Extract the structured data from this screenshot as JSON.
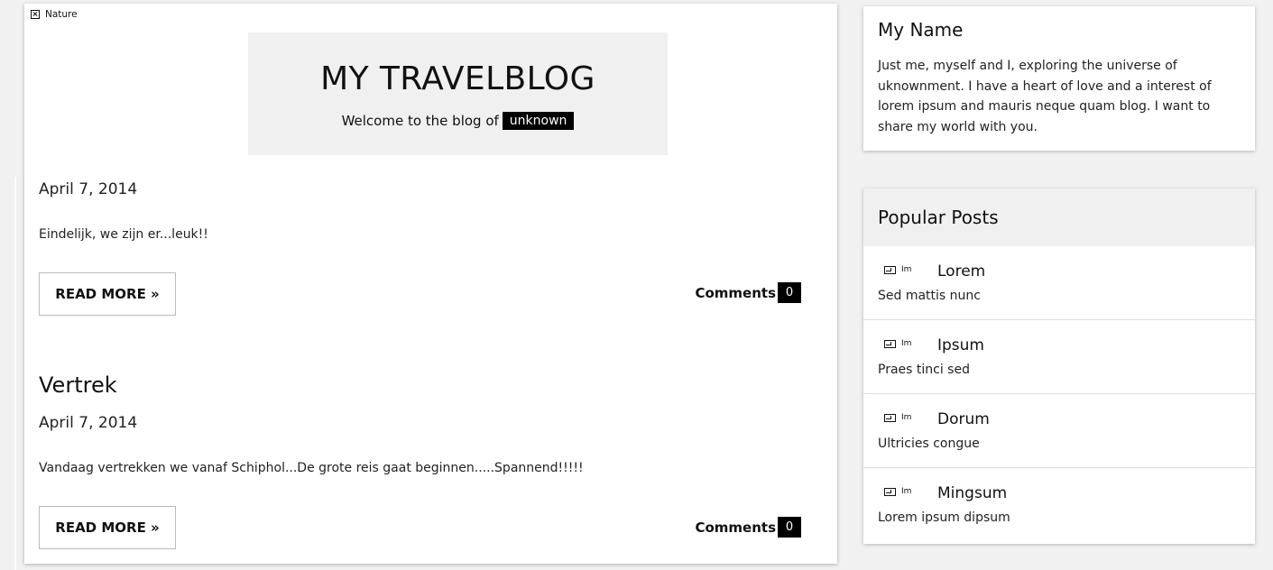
{
  "main": {
    "header_image_alt": "Nature",
    "title": "MY TRAVELBLOG",
    "welcome_text": "Welcome to the blog of",
    "owner": "unknown"
  },
  "posts": [
    {
      "title": "",
      "date": "April 7, 2014",
      "excerpt": "Eindelijk, we zijn er...leuk!!",
      "read_more": "READ MORE »",
      "comments_label": "Comments",
      "comments_count": "0"
    },
    {
      "title": "Vertrek",
      "date": "April 7, 2014",
      "excerpt": "Vandaag vertrekken we vanaf Schiphol...De grote reis gaat beginnen.....Spannend!!!!!",
      "read_more": "READ MORE »",
      "comments_label": "Comments",
      "comments_count": "0"
    }
  ],
  "sidebar": {
    "about": {
      "title": "My Name",
      "text": "Just me, myself and I, exploring the universe of uknownment. I have a heart of love and a interest of lorem ipsum and mauris neque quam blog. I want to share my world with you."
    },
    "popular": {
      "title": "Popular Posts",
      "items": [
        {
          "thumb_text": "Im",
          "title": "Lorem",
          "subtitle": "Sed mattis nunc"
        },
        {
          "thumb_text": "Im",
          "title": "Ipsum",
          "subtitle": "Praes tinci sed"
        },
        {
          "thumb_text": "Im",
          "title": "Dorum",
          "subtitle": "Ultricies congue"
        },
        {
          "thumb_text": "Im",
          "title": "Mingsum",
          "subtitle": "Lorem ipsum dipsum"
        }
      ]
    }
  },
  "colors": {
    "background": "#f1f1f1",
    "card": "#ffffff",
    "header_box": "#f0f0f0",
    "badge": "#000000"
  }
}
